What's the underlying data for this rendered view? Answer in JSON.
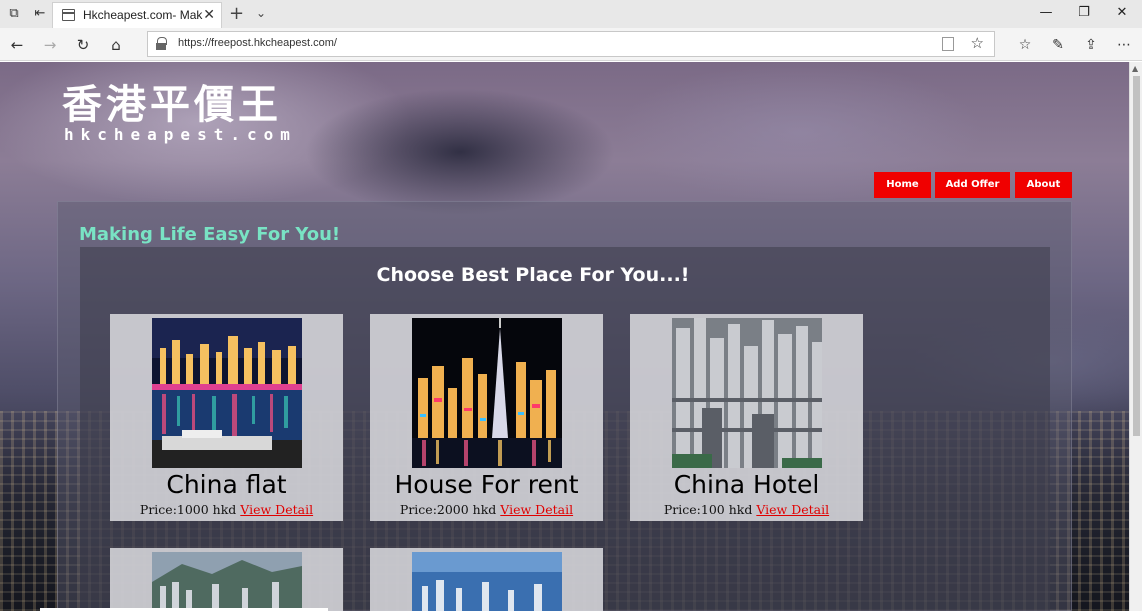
{
  "browser": {
    "tab_title": "Hkcheapest.com- Making Life Easy For You!",
    "url": "https://freepost.hkcheapest.com/"
  },
  "site": {
    "logo_cn": "香港平價王",
    "logo_en": "hkcheapest.com",
    "nav": [
      "Home",
      "Add Offer",
      "About"
    ],
    "tagline": "Making Life Easy For You!",
    "heading": "Choose Best Place For You...!"
  },
  "listings": [
    {
      "name": "China flat",
      "price": "Price:1000 hkd",
      "link": "View Detail"
    },
    {
      "name": "House For rent",
      "price": "Price:2000 hkd",
      "link": "View Detail"
    },
    {
      "name": "China Hotel",
      "price": "Price:100 hkd",
      "link": "View Detail"
    }
  ],
  "colors": {
    "nav_bg": "#f00000",
    "tagline": "#79e3c4",
    "link": "#e00000"
  }
}
